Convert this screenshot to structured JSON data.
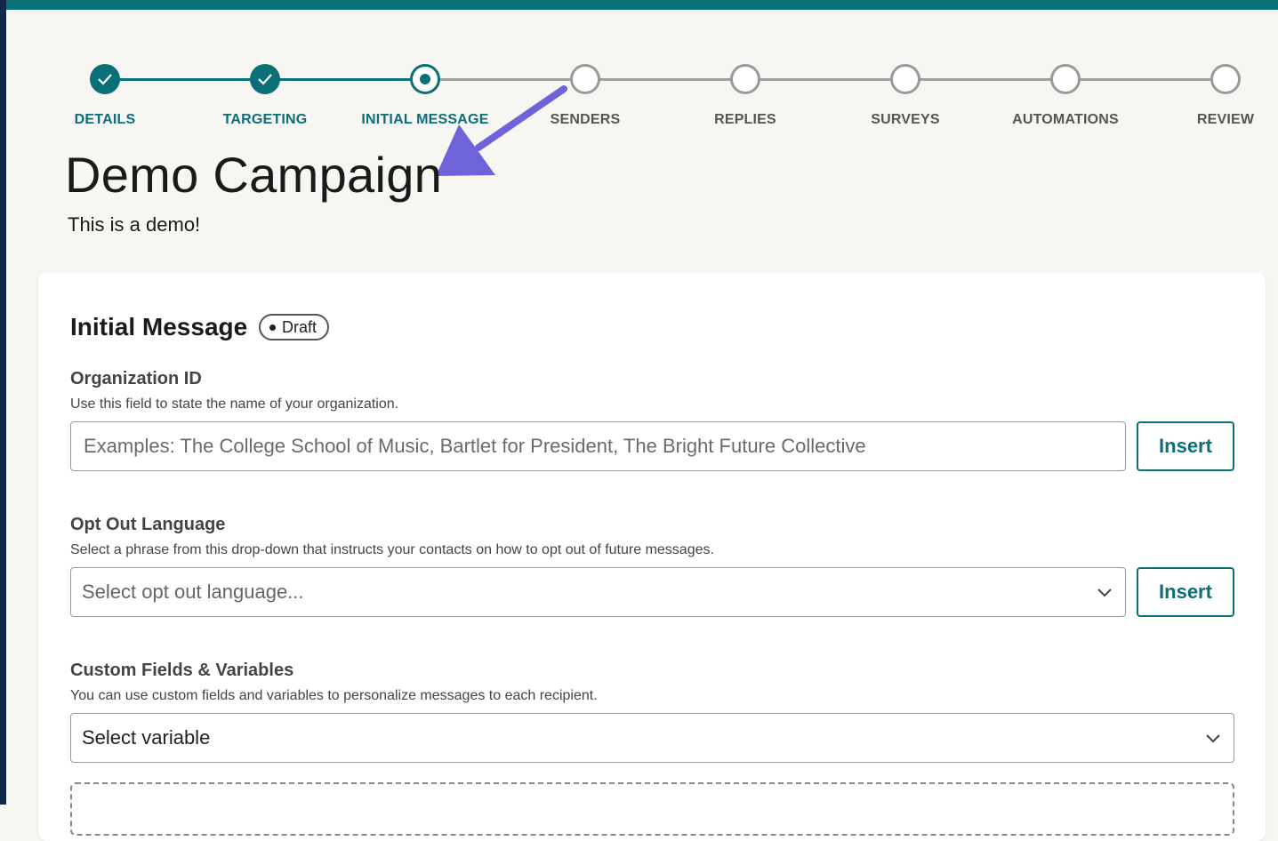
{
  "stepper": {
    "steps": [
      {
        "label": "DETAILS",
        "state": "done"
      },
      {
        "label": "TARGETING",
        "state": "done"
      },
      {
        "label": "INITIAL MESSAGE",
        "state": "current"
      },
      {
        "label": "SENDERS",
        "state": "todo"
      },
      {
        "label": "REPLIES",
        "state": "todo"
      },
      {
        "label": "SURVEYS",
        "state": "todo"
      },
      {
        "label": "AUTOMATIONS",
        "state": "todo"
      },
      {
        "label": "REVIEW",
        "state": "todo"
      }
    ]
  },
  "campaign": {
    "title": "Demo Campaign",
    "subtitle": "This is a demo!"
  },
  "card": {
    "title": "Initial Message",
    "badge": "Draft"
  },
  "fields": {
    "org": {
      "label": "Organization ID",
      "help": "Use this field to state the name of your organization.",
      "placeholder": "Examples: The College School of Music, Bartlet for President, The Bright Future Collective",
      "button": "Insert"
    },
    "optout": {
      "label": "Opt Out Language",
      "help": "Select a phrase from this drop-down that instructs your contacts on how to opt out of future messages.",
      "selected": "Select opt out language...",
      "button": "Insert"
    },
    "custom": {
      "label": "Custom Fields & Variables",
      "help": "You can use custom fields and variables to personalize messages to each recipient.",
      "selected": "Select variable"
    }
  },
  "colors": {
    "accent": "#0b6f78",
    "annotation_arrow": "#6f63d9",
    "inactive": "#9a9a9a"
  },
  "icons": {
    "done_step": "check-icon",
    "dropdown": "chevron-down-icon",
    "annotation": "arrow-annotation"
  }
}
